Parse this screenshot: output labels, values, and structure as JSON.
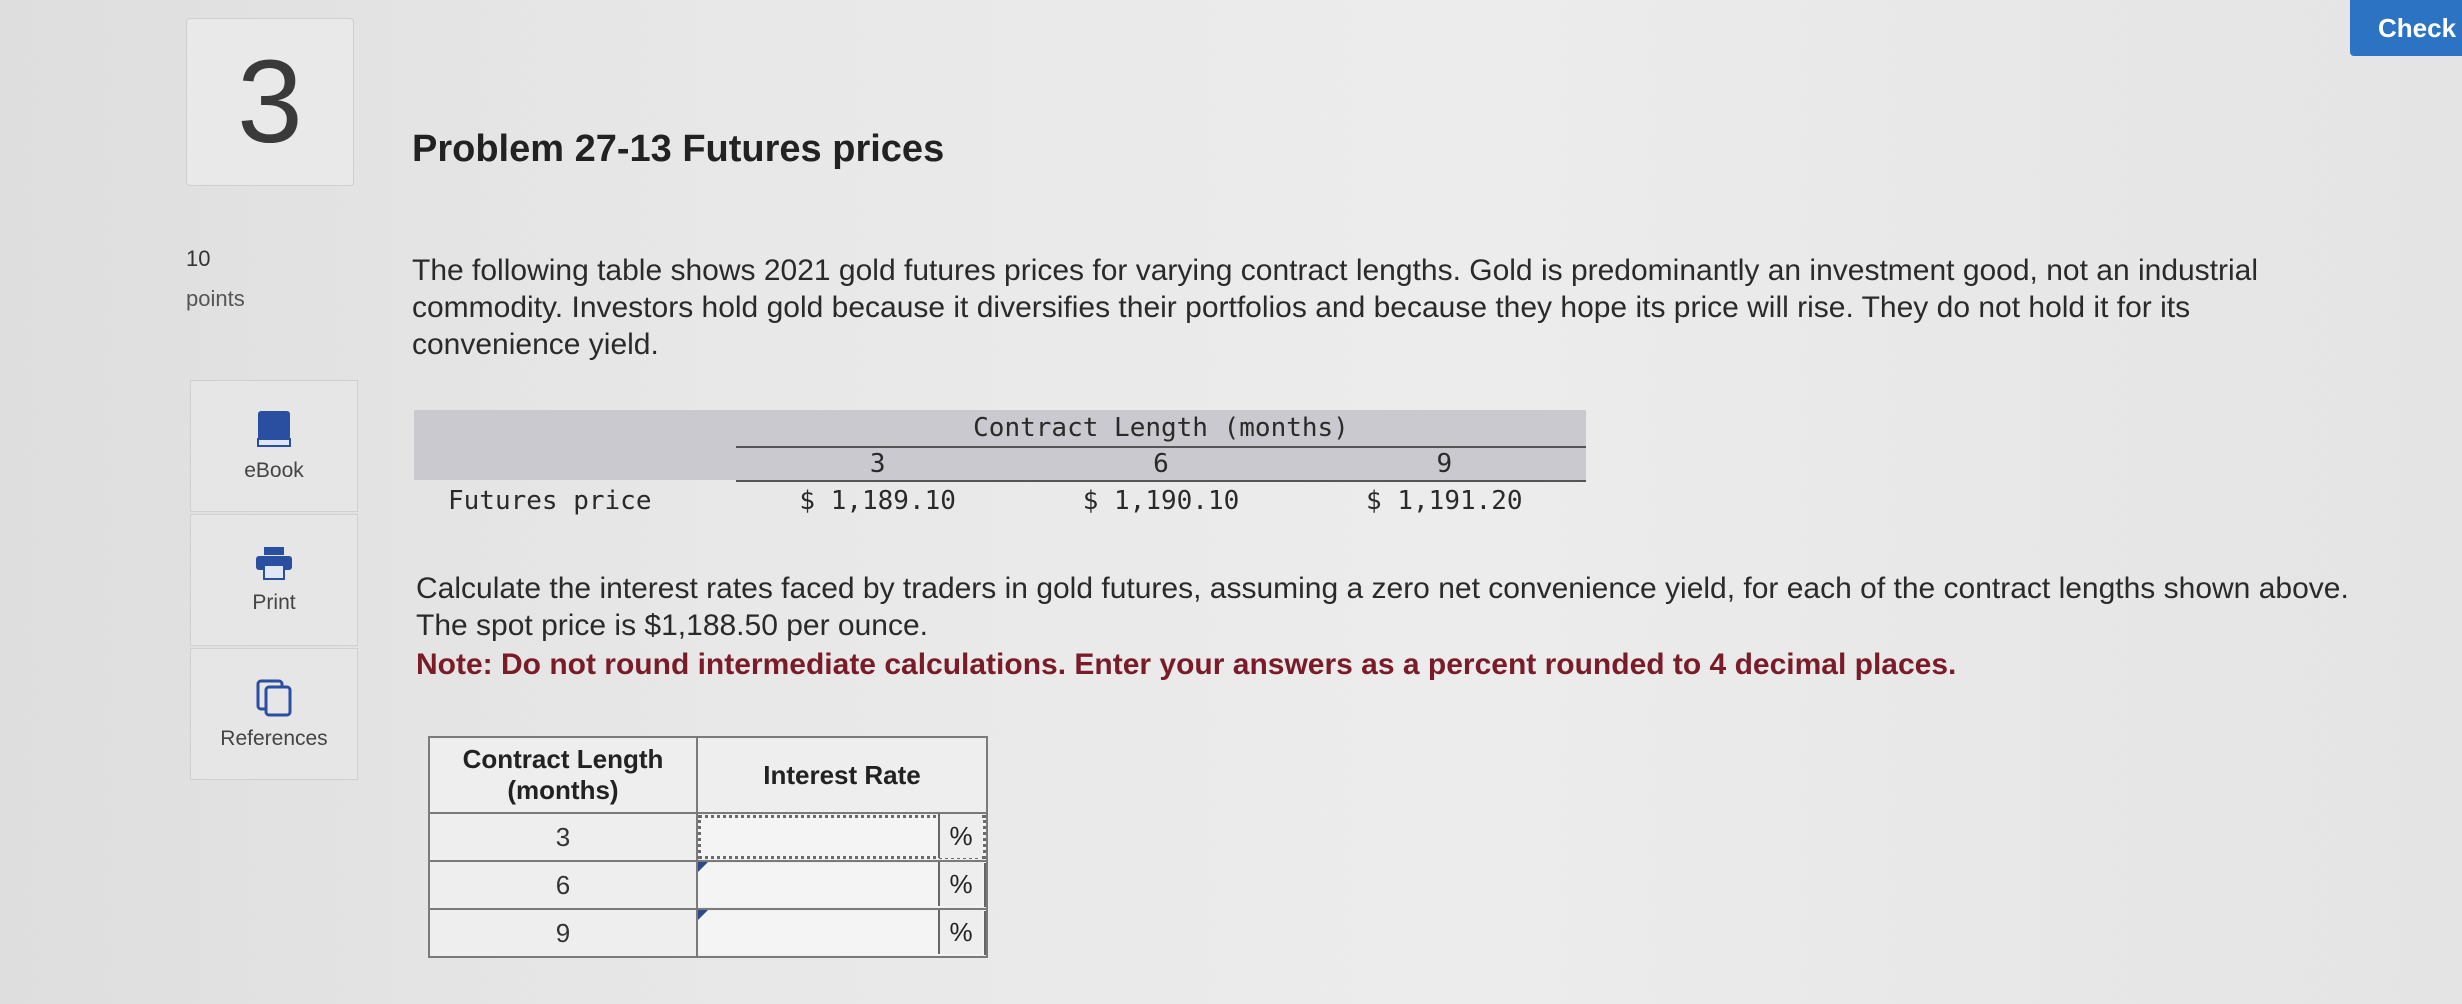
{
  "question": {
    "number": "3",
    "points_value": "10",
    "points_label": "points",
    "title": "Problem 27-13 Futures prices",
    "intro": "The following table shows 2021 gold futures prices for varying contract lengths. Gold is predominantly an investment good, not an industrial commodity. Investors hold gold because it diversifies their portfolios and because they hope its price will rise. They do not hold it for its convenience yield.",
    "instructions": "Calculate the interest rates faced by traders in gold futures, assuming a zero net convenience yield, for each of the contract lengths shown above. The spot price is $1,188.50 per ounce.",
    "note": "Note: Do not round intermediate calculations. Enter your answers as a percent rounded to 4 decimal places."
  },
  "side_panel": {
    "items": [
      {
        "label": "eBook",
        "icon": "book-icon"
      },
      {
        "label": "Print",
        "icon": "printer-icon"
      },
      {
        "label": "References",
        "icon": "references-icon"
      }
    ]
  },
  "given_table": {
    "group_header": "Contract Length (months)",
    "columns": [
      "3",
      "6",
      "9"
    ],
    "row_label": "Futures price",
    "values": [
      "$ 1,189.10",
      "$ 1,190.10",
      "$ 1,191.20"
    ]
  },
  "answer_table": {
    "header_length": "Contract Length (months)",
    "header_rate": "Interest Rate",
    "unit": "%",
    "rows": [
      {
        "length": "3",
        "value": ""
      },
      {
        "length": "6",
        "value": ""
      },
      {
        "length": "9",
        "value": ""
      }
    ]
  },
  "toolbar": {
    "check_label": "Check"
  }
}
